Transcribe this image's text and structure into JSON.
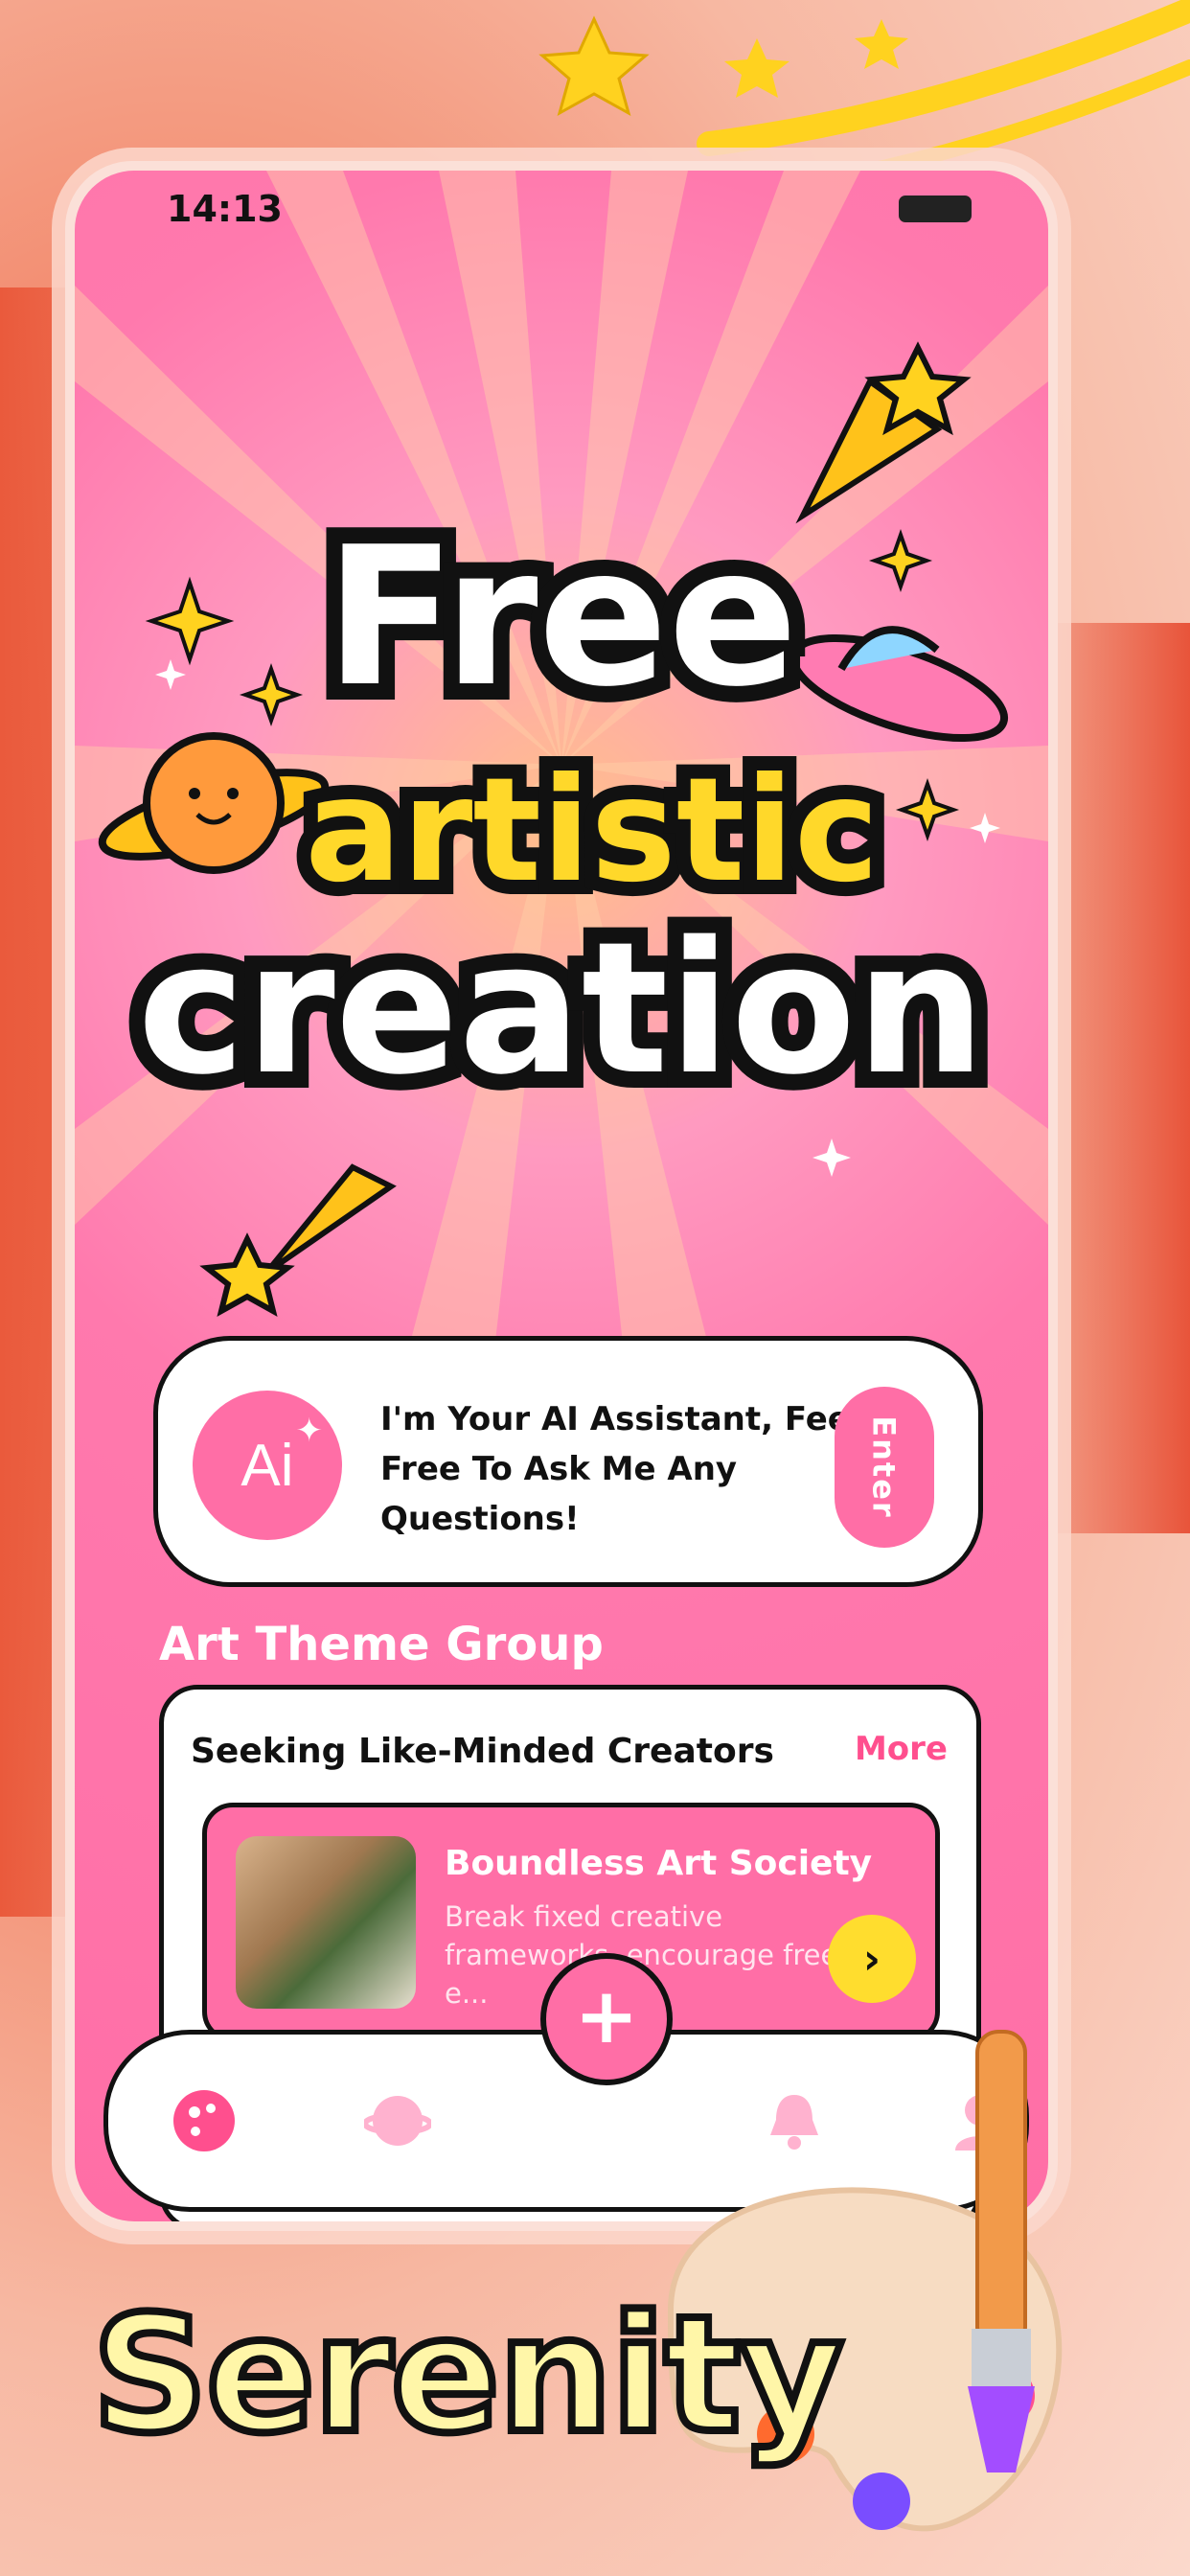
{
  "status": {
    "time": "14:13"
  },
  "hero": {
    "line1": "Free",
    "line2": "artistic",
    "line3": "creation"
  },
  "ai_card": {
    "badge_text": "Ai",
    "message": "I'm Your AI Assistant, Feel Free To Ask Me Any Questions!",
    "enter_label": "Enter"
  },
  "section": {
    "title": "Art Theme Group"
  },
  "group": {
    "heading": "Seeking Like-Minded Creators",
    "more_label": "More",
    "item": {
      "title": "Boundless Art Society",
      "desc": "Break fixed creative frameworks, encourage free e..."
    }
  },
  "tabbar": {
    "plus_label": "+"
  },
  "brand": {
    "name": "Serenity"
  },
  "colors": {
    "pink": "#ff6ea6",
    "yellow": "#ffdd2e",
    "dark": "#111111"
  }
}
